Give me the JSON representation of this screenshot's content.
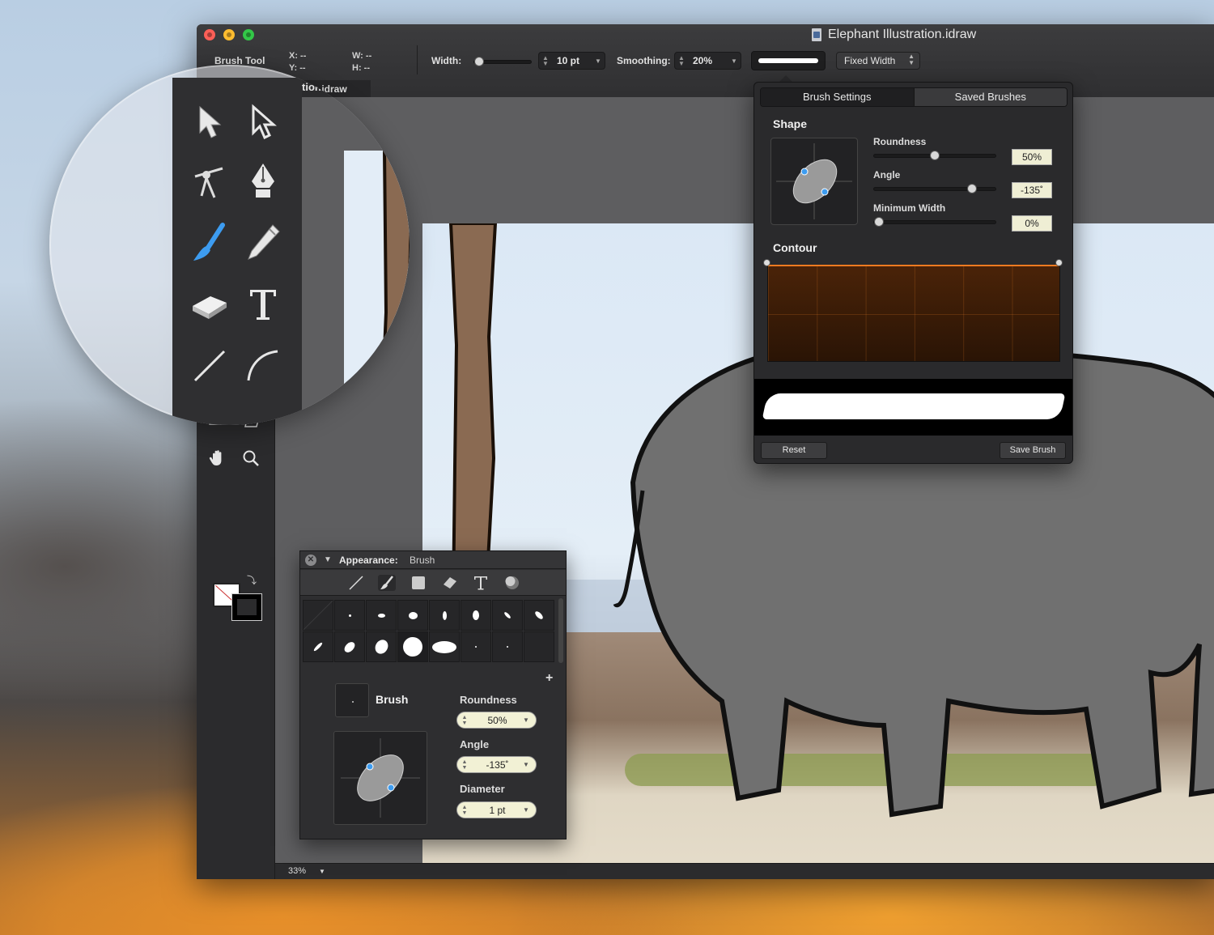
{
  "window": {
    "title": "Elephant Illustration.idraw"
  },
  "toolbar": {
    "tool_name": "Brush Tool",
    "x_label": "X: --",
    "y_label": "Y: --",
    "w_label": "W: --",
    "h_label": "H: --",
    "width_label": "Width:",
    "width_value": "10 pt",
    "smoothing_label": "Smoothing:",
    "smoothing_value": "20%",
    "width_mode": "Fixed Width"
  },
  "document_tab": {
    "label": "tion.idraw"
  },
  "status": {
    "zoom": "33%"
  },
  "tools": [
    {
      "name": "selection-arrow-icon"
    },
    {
      "name": "direct-selection-arrow-icon"
    },
    {
      "name": "node-tool-icon"
    },
    {
      "name": "pen-nib-icon"
    },
    {
      "name": "brush-icon",
      "active": true
    },
    {
      "name": "pencil-icon"
    },
    {
      "name": "eraser-icon"
    },
    {
      "name": "text-icon"
    },
    {
      "name": "line-icon"
    },
    {
      "name": "arc-icon"
    }
  ],
  "brush_settings": {
    "tabs": [
      "Brush Settings",
      "Saved Brushes"
    ],
    "active_tab": 0,
    "shape_title": "Shape",
    "roundness_label": "Roundness",
    "roundness_value": "50%",
    "roundness_level": 0.5,
    "angle_label": "Angle",
    "angle_value": "-135˚",
    "angle_level": 0.83,
    "min_width_label": "Minimum Width",
    "min_width_value": "0%",
    "min_width_level": 0.0,
    "contour_title": "Contour",
    "reset_label": "Reset",
    "save_label": "Save Brush"
  },
  "appearance": {
    "title": "Appearance:",
    "subtitle": "Brush",
    "brush_label": "Brush",
    "roundness_label": "Roundness",
    "roundness_value": "50%",
    "angle_label": "Angle",
    "angle_value": "-135˚",
    "diameter_label": "Diameter",
    "diameter_value": "1 pt",
    "add_symbol": "+"
  },
  "colors": {
    "accent": "#3d9cf0",
    "contour_line": "#f07a20",
    "field_bg": "#efeed4"
  }
}
